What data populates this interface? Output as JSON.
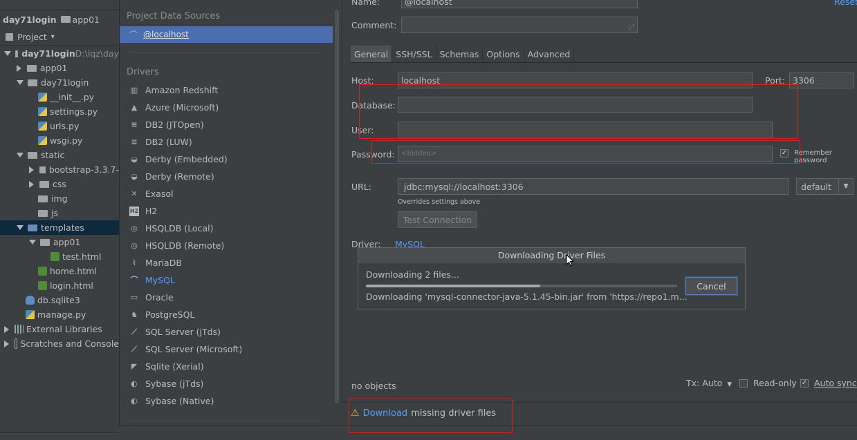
{
  "breadcrumb": {
    "items": [
      "day71login",
      "app01"
    ]
  },
  "project_bar": {
    "label": "Project",
    "arrow": "▾"
  },
  "tree": [
    {
      "label": "day71login",
      "extra": "D:\\lqz\\day",
      "indent": 0,
      "arrow": "down",
      "icon": "folder",
      "bold": true
    },
    {
      "label": "app01",
      "indent": 1,
      "arrow": "right",
      "icon": "folder"
    },
    {
      "label": "day71login",
      "indent": 1,
      "arrow": "down",
      "icon": "folder"
    },
    {
      "label": "__init__.py",
      "indent": 2,
      "icon": "py"
    },
    {
      "label": "settings.py",
      "indent": 2,
      "icon": "py"
    },
    {
      "label": "urls.py",
      "indent": 2,
      "icon": "py"
    },
    {
      "label": "wsgi.py",
      "indent": 2,
      "icon": "py"
    },
    {
      "label": "static",
      "indent": 1,
      "arrow": "down",
      "icon": "folder"
    },
    {
      "label": "bootstrap-3.3.7-",
      "indent": 2,
      "arrow": "right",
      "icon": "folder"
    },
    {
      "label": "css",
      "indent": 2,
      "arrow": "right",
      "icon": "folder"
    },
    {
      "label": "img",
      "indent": 2,
      "icon": "folder"
    },
    {
      "label": "js",
      "indent": 2,
      "icon": "folder"
    },
    {
      "label": "templates",
      "indent": 1,
      "arrow": "down",
      "icon": "folder-blue",
      "selected": true
    },
    {
      "label": "app01",
      "indent": 2,
      "arrow": "down",
      "icon": "folder"
    },
    {
      "label": "test.html",
      "indent": 3,
      "icon": "html"
    },
    {
      "label": "home.html",
      "indent": 2,
      "icon": "html"
    },
    {
      "label": "login.html",
      "indent": 2,
      "icon": "html"
    },
    {
      "label": "db.sqlite3",
      "indent": 1,
      "icon": "db"
    },
    {
      "label": "manage.py",
      "indent": 1,
      "icon": "py"
    },
    {
      "label": "External Libraries",
      "indent": 0,
      "arrow": "right",
      "icon": "lib"
    },
    {
      "label": "Scratches and Console",
      "indent": 0,
      "arrow": "right",
      "icon": "scratch"
    }
  ],
  "left_panel": {
    "data_sources_header": "Project Data Sources",
    "data_source": "@localhost",
    "drivers_header": "Drivers",
    "drivers": [
      {
        "label": "Amazon Redshift",
        "icon": "redshift-icon",
        "glyph": "▥"
      },
      {
        "label": "Azure (Microsoft)",
        "icon": "azure-icon",
        "glyph": "▲"
      },
      {
        "label": "DB2 (JTOpen)",
        "icon": "ibm-icon",
        "glyph": "≡"
      },
      {
        "label": "DB2 (LUW)",
        "icon": "ibm-icon",
        "glyph": "≡"
      },
      {
        "label": "Derby (Embedded)",
        "icon": "derby-icon",
        "glyph": "◒"
      },
      {
        "label": "Derby (Remote)",
        "icon": "derby-icon",
        "glyph": "◒"
      },
      {
        "label": "Exasol",
        "icon": "exasol-icon",
        "glyph": "✕"
      },
      {
        "label": "H2",
        "icon": "h2-icon",
        "glyph": "H2"
      },
      {
        "label": "HSQLDB (Local)",
        "icon": "hsqldb-icon",
        "glyph": "◎"
      },
      {
        "label": "HSQLDB (Remote)",
        "icon": "hsqldb-icon",
        "glyph": "◎"
      },
      {
        "label": "MariaDB",
        "icon": "mariadb-icon",
        "glyph": "⌇"
      },
      {
        "label": "MySQL",
        "icon": "mysql-icon",
        "glyph": "⌒",
        "active": true
      },
      {
        "label": "Oracle",
        "icon": "oracle-icon",
        "glyph": "▭"
      },
      {
        "label": "PostgreSQL",
        "icon": "postgresql-icon",
        "glyph": "♞"
      },
      {
        "label": "SQL Server (jTds)",
        "icon": "sqlserver-icon",
        "glyph": "⟋"
      },
      {
        "label": "SQL Server (Microsoft)",
        "icon": "sqlserver-icon",
        "glyph": "⟋"
      },
      {
        "label": "Sqlite (Xerial)",
        "icon": "sqlite-icon",
        "glyph": "◤"
      },
      {
        "label": "Sybase (jTds)",
        "icon": "sybase-icon",
        "glyph": "◐"
      },
      {
        "label": "Sybase (Native)",
        "icon": "sybase-icon",
        "glyph": "◐"
      }
    ]
  },
  "form": {
    "name_label": "Name:",
    "name_value": "@localhost",
    "reset": "Reset",
    "comment_label": "Comment:",
    "tabs": [
      "General",
      "SSH/SSL",
      "Schemas",
      "Options",
      "Advanced"
    ],
    "host_label": "Host:",
    "host_value": "localhost",
    "port_label": "Port:",
    "port_value": "3306",
    "database_label": "Database:",
    "user_label": "User:",
    "password_label": "Password:",
    "password_placeholder": "<hidden>",
    "remember_password": "Remember password",
    "url_label": "URL:",
    "url_value": "jdbc:mysql://localhost:3306",
    "url_mode": "default",
    "overrides_note": "Overrides settings above",
    "test_connection": "Test Connection",
    "driver_label": "Driver:",
    "driver_value": "MySQL",
    "no_objects": "no objects",
    "tx_label": "Tx: Auto",
    "read_only": "Read-only",
    "auto_sync": "Auto sync",
    "download_link": "Download",
    "download_rest": "missing driver files"
  },
  "popup": {
    "title": "Downloading Driver Files",
    "status": "Downloading 2 files...",
    "progress": 0.56,
    "detail": "Downloading 'mysql-connector-java-5.1.45-bin.jar' from 'https://repo1.m...",
    "cancel": "Cancel"
  }
}
